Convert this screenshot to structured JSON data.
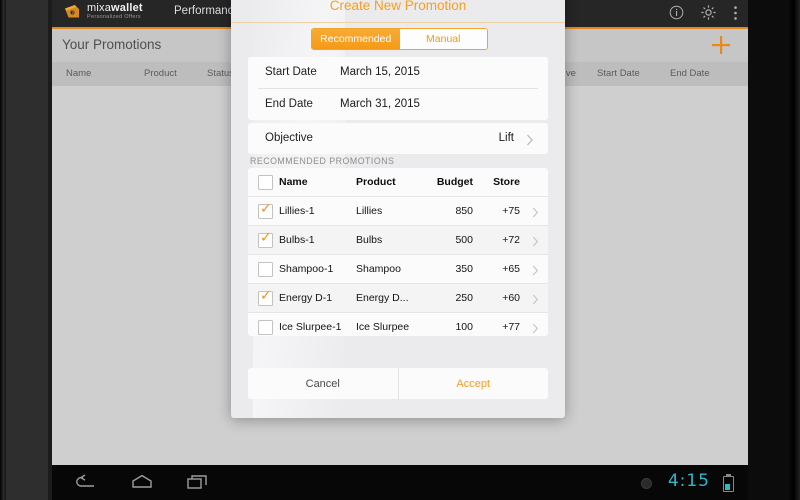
{
  "app": {
    "brand": {
      "name_light": "mixa",
      "name_bold": "wallet",
      "tagline": "Personalized Offers",
      "logo_icon": "wallet-icon"
    },
    "nav": {
      "performance_label": "Performance"
    },
    "topbar_icons": [
      {
        "name": "info-icon",
        "glyph": "i"
      },
      {
        "name": "settings-gear-icon",
        "glyph": "gear"
      },
      {
        "name": "overflow-menu-icon",
        "glyph": "kebab"
      }
    ],
    "page": {
      "title": "Your Promotions",
      "add_button": "add-promotion-icon"
    },
    "background_table": {
      "columns": [
        "Name",
        "Product",
        "Status",
        "...ve",
        "Start Date",
        "End Date"
      ]
    }
  },
  "modal": {
    "title": "Create New Promotion",
    "segments": [
      {
        "label": "Recommended",
        "selected": true
      },
      {
        "label": "Manual",
        "selected": false
      }
    ],
    "fields": [
      {
        "label": "Start Date",
        "value": "March 15, 2015"
      },
      {
        "label": "End Date",
        "value": "March 31, 2015"
      }
    ],
    "objective": {
      "label": "Objective",
      "value": "Lift",
      "chevron": "chevron-right-icon"
    },
    "section_label": "RECOMMENDED PROMOTIONS",
    "table": {
      "columns": [
        "Name",
        "Product",
        "Budget",
        "Store"
      ],
      "header_checkbox_checked": false,
      "rows": [
        {
          "checked": true,
          "name": "Lillies-1",
          "product": "Lillies",
          "budget": "850",
          "store": "+75"
        },
        {
          "checked": true,
          "name": "Bulbs-1",
          "product": "Bulbs",
          "budget": "500",
          "store": "+72"
        },
        {
          "checked": false,
          "name": "Shampoo-1",
          "product": "Shampoo",
          "budget": "350",
          "store": "+65"
        },
        {
          "checked": true,
          "name": "Energy D-1",
          "product": "Energy D...",
          "budget": "250",
          "store": "+60"
        },
        {
          "checked": false,
          "name": "Ice Slurpee-1",
          "product": "Ice Slurpee",
          "budget": "100",
          "store": "+77"
        }
      ]
    },
    "actions": {
      "cancel": "Cancel",
      "accept": "Accept"
    }
  },
  "system_bar": {
    "back_icon": "back-arrow-icon",
    "home_icon": "home-icon",
    "recents_icon": "recent-apps-icon",
    "clock": "4:15",
    "battery_icon": "battery-icon"
  },
  "colors": {
    "accent_orange": "#f5a01f",
    "segment_orange": "#f59a16",
    "clock_cyan": "#2eb8c8",
    "modal_bg": "#ebebee",
    "card_bg": "#fbfbfb",
    "screen_bg": "#cccccc"
  }
}
